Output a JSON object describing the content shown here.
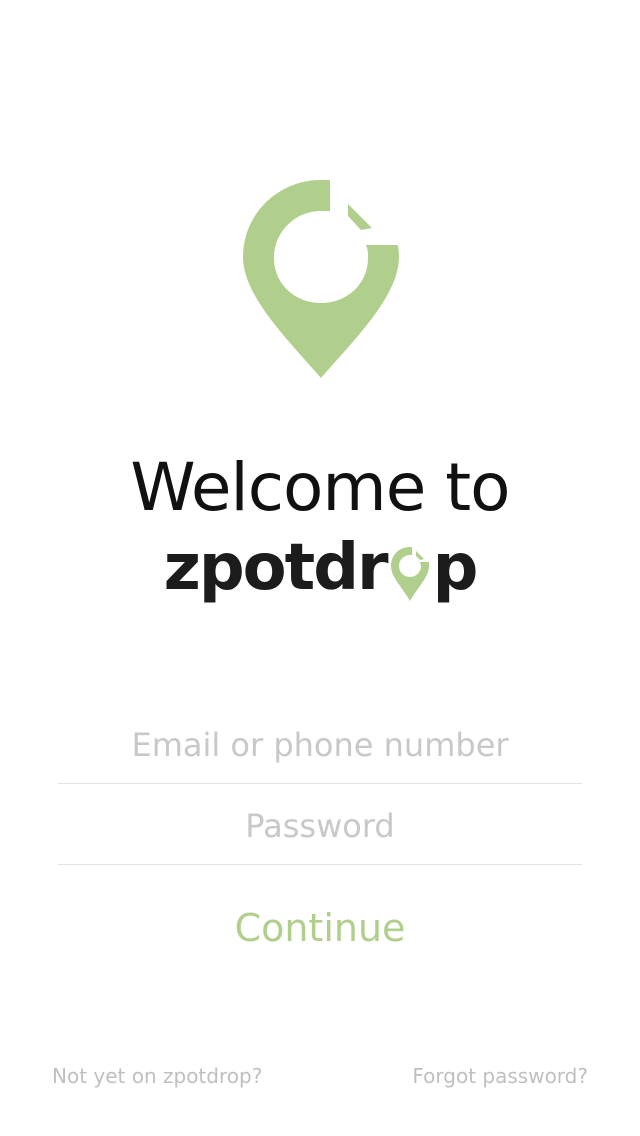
{
  "brand": {
    "name": "zpotdrop",
    "wordmark_prefix": "zpotdr",
    "wordmark_suffix": "p",
    "accent_color": "#b1cf8c",
    "logo_icon": "map-pin-icon"
  },
  "welcome": {
    "heading": "Welcome to"
  },
  "login_form": {
    "email_placeholder": "Email or phone number",
    "email_value": "",
    "password_placeholder": "Password",
    "password_value": "",
    "continue_label": "Continue"
  },
  "footer": {
    "signup_link": "Not yet on zpotdrop?",
    "forgot_link": "Forgot password?"
  }
}
